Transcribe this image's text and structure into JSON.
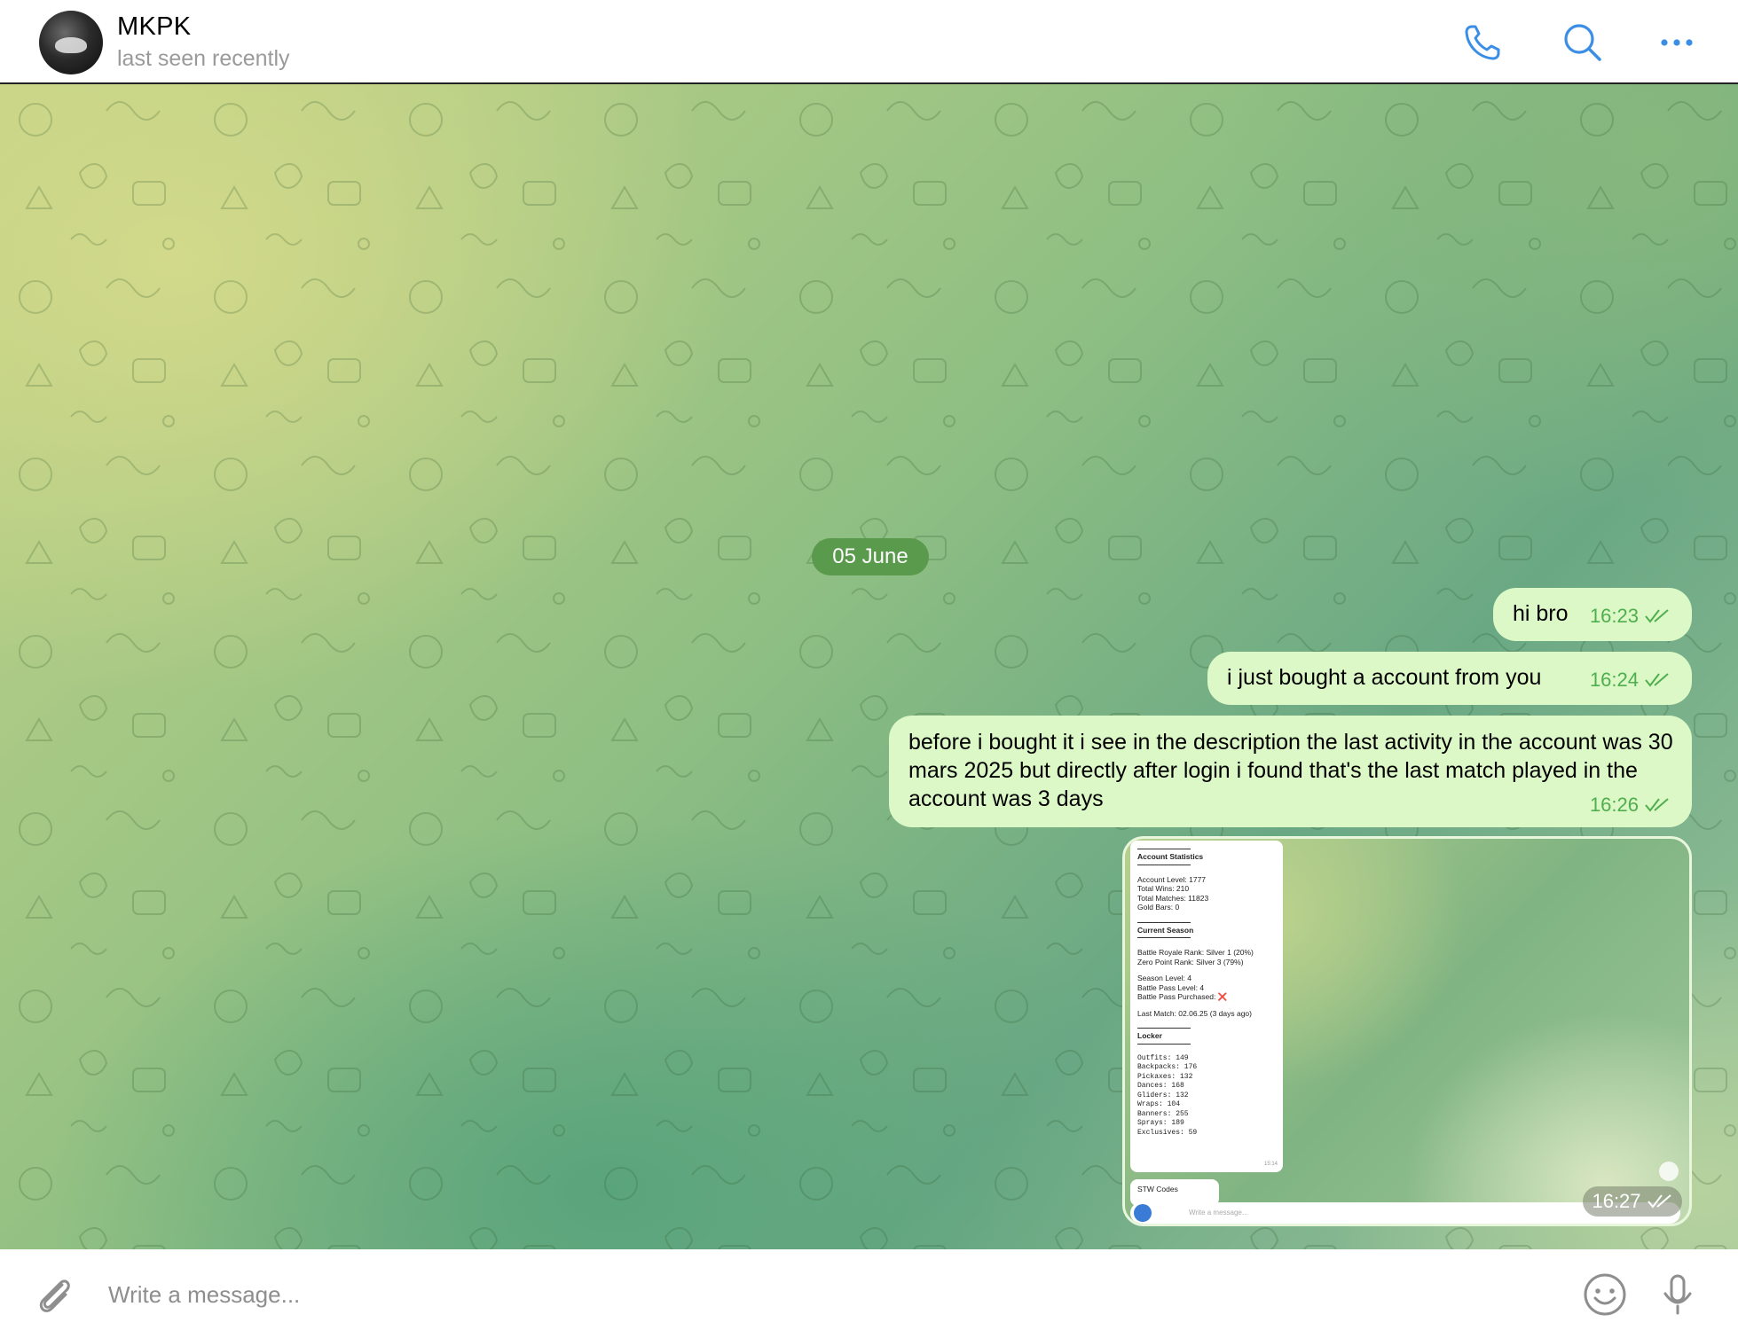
{
  "header": {
    "contact_name": "MKPK",
    "status": "last seen recently",
    "icons": [
      "phone-icon",
      "search-icon",
      "more-icon"
    ],
    "accent": "#3a8ee6"
  },
  "chat": {
    "date_separator": "05 June",
    "messages": [
      {
        "text": "hi bro",
        "time": "16:23",
        "status": "read"
      },
      {
        "text": "i just bought a account from you",
        "time": "16:24",
        "status": "read"
      },
      {
        "text": "before i bought it i see in the description the last activity in the account was 30 mars 2025 but directly after login i found that's the last match played in the account was 3 days",
        "time": "16:26",
        "status": "read"
      },
      {
        "type": "image",
        "time": "16:27",
        "status": "read"
      }
    ],
    "screenshot": {
      "account_title": "Account Statistics",
      "account_lines": [
        "Account Level: 1777",
        "Total Wins: 210",
        "Total Matches: 11823",
        "Gold Bars: 0"
      ],
      "season_title": "Current Season",
      "season_ranks": [
        "Battle Royale Rank: Silver 1 (20%)",
        "Zero Point Rank: Silver 3 (79%)"
      ],
      "season_lines": [
        "Season Level: 4",
        "Battle Pass Level: 4",
        "Battle Pass Purchased: ❌"
      ],
      "last_match": "Last Match: 02.06.25 (3 days ago)",
      "locker_title": "Locker",
      "locker_lines": [
        "Outfits: 149",
        "Backpacks: 176",
        "Pickaxes: 132",
        "Dances: 168",
        "Gliders: 132",
        "Wraps: 104",
        "Banners: 255",
        "Sprays: 189",
        "Exclusives: 59"
      ],
      "card_time": "15:14",
      "stw_title": "STW Codes",
      "input_placeholder": "Write a message..."
    },
    "bubble_color": "#dcf8c6",
    "time_color": "#4fae4e",
    "date_pill_color": "#5a9a4c"
  },
  "composer": {
    "placeholder": "Write a message...",
    "icons": [
      "attach-icon",
      "emoji-icon",
      "microphone-icon"
    ]
  }
}
